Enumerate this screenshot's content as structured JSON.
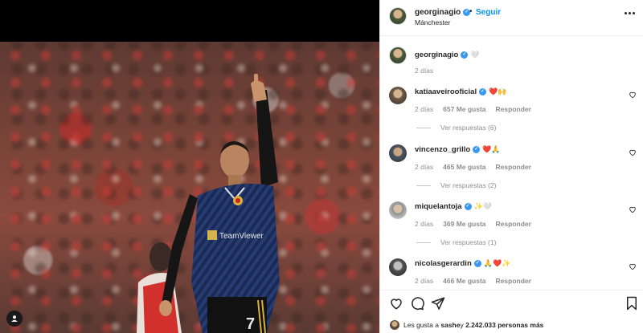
{
  "header": {
    "username": "georginagio",
    "dot": "•",
    "follow_label": "Seguir",
    "location": "Mánchester"
  },
  "caption": {
    "username": "georginagio",
    "text": "🤍",
    "time": "2 días"
  },
  "comments": [
    {
      "username": "katiaaveirooficial",
      "text": "❤️🙌",
      "time": "2 días",
      "likes": "657 Me gusta",
      "reply_label": "Responder",
      "replies": "Ver respuestas (6)"
    },
    {
      "username": "vincenzo_grillo",
      "text": "❤️🙏",
      "time": "2 días",
      "likes": "465 Me gusta",
      "reply_label": "Responder",
      "replies": "Ver respuestas (2)"
    },
    {
      "username": "miquelantoja",
      "text": "✨🤍",
      "time": "2 días",
      "likes": "369 Me gusta",
      "reply_label": "Responder",
      "replies": "Ver respuestas (1)"
    },
    {
      "username": "nicolasgerardin",
      "text": "🙏❤️✨",
      "time": "2 días",
      "likes": "466 Me gusta",
      "reply_label": "Responder"
    }
  ],
  "footer": {
    "liked_by_prefix": "Les gusta a ",
    "liked_by_user": "sashe",
    "liked_by_mid": " y ",
    "liked_by_count": "2.242.033 personas más"
  },
  "player": {
    "shirt_number": "7",
    "sponsor": "TeamViewer"
  },
  "icons": [
    "verified-icon",
    "more-options-icon",
    "heart-icon",
    "comment-icon",
    "share-icon",
    "bookmark-icon",
    "user-tag-icon"
  ],
  "colors": {
    "link": "#0095f6",
    "verified": "#3897f0",
    "muted": "#8e8e8e",
    "text": "#262626"
  }
}
